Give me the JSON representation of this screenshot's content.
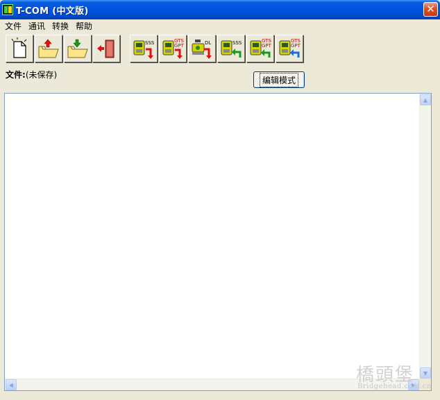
{
  "window": {
    "title": "T-COM (中文版)",
    "close_glyph": "✕"
  },
  "menu": [
    {
      "label": "文件"
    },
    {
      "label": "通讯"
    },
    {
      "label": "转换"
    },
    {
      "label": "帮助"
    }
  ],
  "toolbar": {
    "buttons": [
      {
        "icon": "new-file-icon"
      },
      {
        "icon": "open-upload-folder-icon"
      },
      {
        "icon": "open-download-folder-icon"
      },
      {
        "icon": "exit-door-icon"
      },
      {
        "icon": "instrument-sss-send-icon",
        "badge": "SSS"
      },
      {
        "icon": "instrument-gts-gpt-send-icon",
        "badge_top": "GTS",
        "badge_bottom": "GPT"
      },
      {
        "icon": "instrument-dl-send-icon",
        "badge": "DL"
      },
      {
        "icon": "instrument-sss-receive-icon",
        "badge": "SSS"
      },
      {
        "icon": "instrument-gts-gpt-receive-icon",
        "badge_top": "GTS",
        "badge_bottom": "GPT"
      },
      {
        "icon": "instrument-gts-gpt-convert-icon",
        "badge_top": "GTS",
        "badge_bottom": "GPT"
      }
    ]
  },
  "file": {
    "label": "文件:",
    "status": "(未保存)"
  },
  "edit_mode_button": {
    "label": "编辑模式"
  },
  "editor": {
    "content": ""
  },
  "watermark": {
    "cn": "橋頭堡",
    "en": "Bridgehead.com.cn"
  },
  "colors": {
    "titlebar": "#0054e3",
    "window_bg": "#ece9d8",
    "send_arrow": "#e01010",
    "receive_arrow": "#1a9a1a",
    "convert_arrow": "#1a6fd0",
    "instrument_body": "#d4d400"
  }
}
